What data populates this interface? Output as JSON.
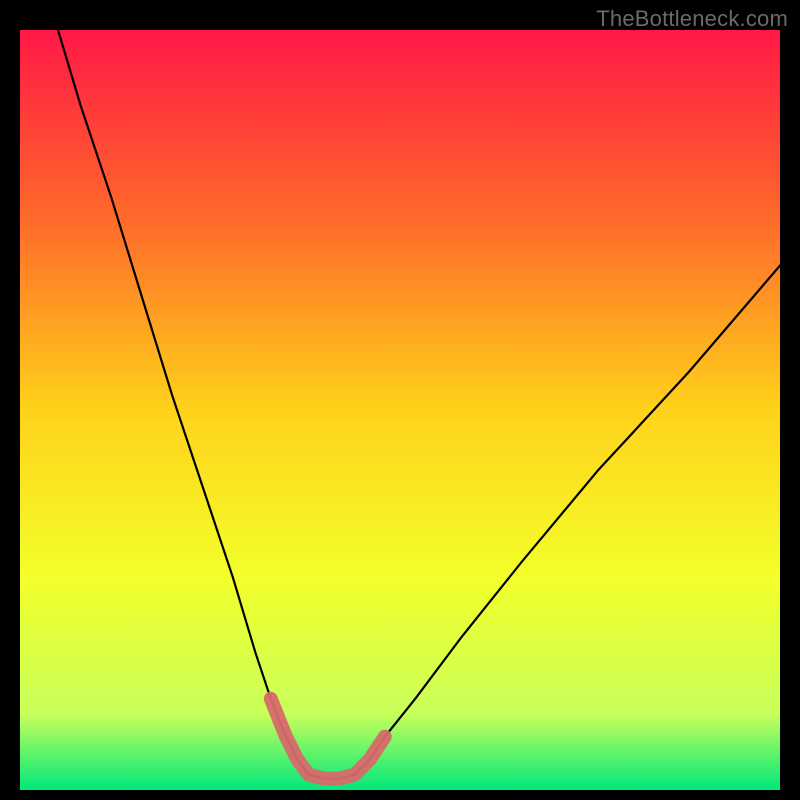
{
  "watermark": "TheBottleneck.com",
  "colors": {
    "frame": "#000000",
    "gradient_top": "#ff1846",
    "gradient_mid_upper": "#ff6a2a",
    "gradient_mid": "#ffd21a",
    "gradient_mid_lower": "#f3ff2a",
    "gradient_lower": "#c8ff5a",
    "gradient_bottom": "#00e87a",
    "curve": "#000000",
    "highlight": "#d66a6a"
  },
  "chart_data": {
    "type": "line",
    "title": "",
    "xlabel": "",
    "ylabel": "",
    "xlim": [
      0,
      100
    ],
    "ylim": [
      0,
      100
    ],
    "series": [
      {
        "name": "bottleneck-curve",
        "x": [
          5,
          8,
          12,
          16,
          20,
          24,
          28,
          31,
          33,
          35,
          36.5,
          38,
          40,
          42,
          44,
          46,
          48,
          52,
          58,
          66,
          76,
          88,
          100
        ],
        "values": [
          100,
          90,
          78,
          65,
          52,
          40,
          28,
          18,
          12,
          7,
          4,
          2,
          1.5,
          1.5,
          2,
          4,
          7,
          12,
          20,
          30,
          42,
          55,
          69
        ]
      },
      {
        "name": "bottom-highlight",
        "x": [
          33,
          35,
          36.5,
          38,
          40,
          42,
          44,
          46,
          48
        ],
        "values": [
          12,
          7,
          4,
          2,
          1.5,
          1.5,
          2,
          4,
          7
        ]
      }
    ],
    "annotations": [
      {
        "text": "TheBottleneck.com",
        "role": "watermark"
      }
    ]
  }
}
